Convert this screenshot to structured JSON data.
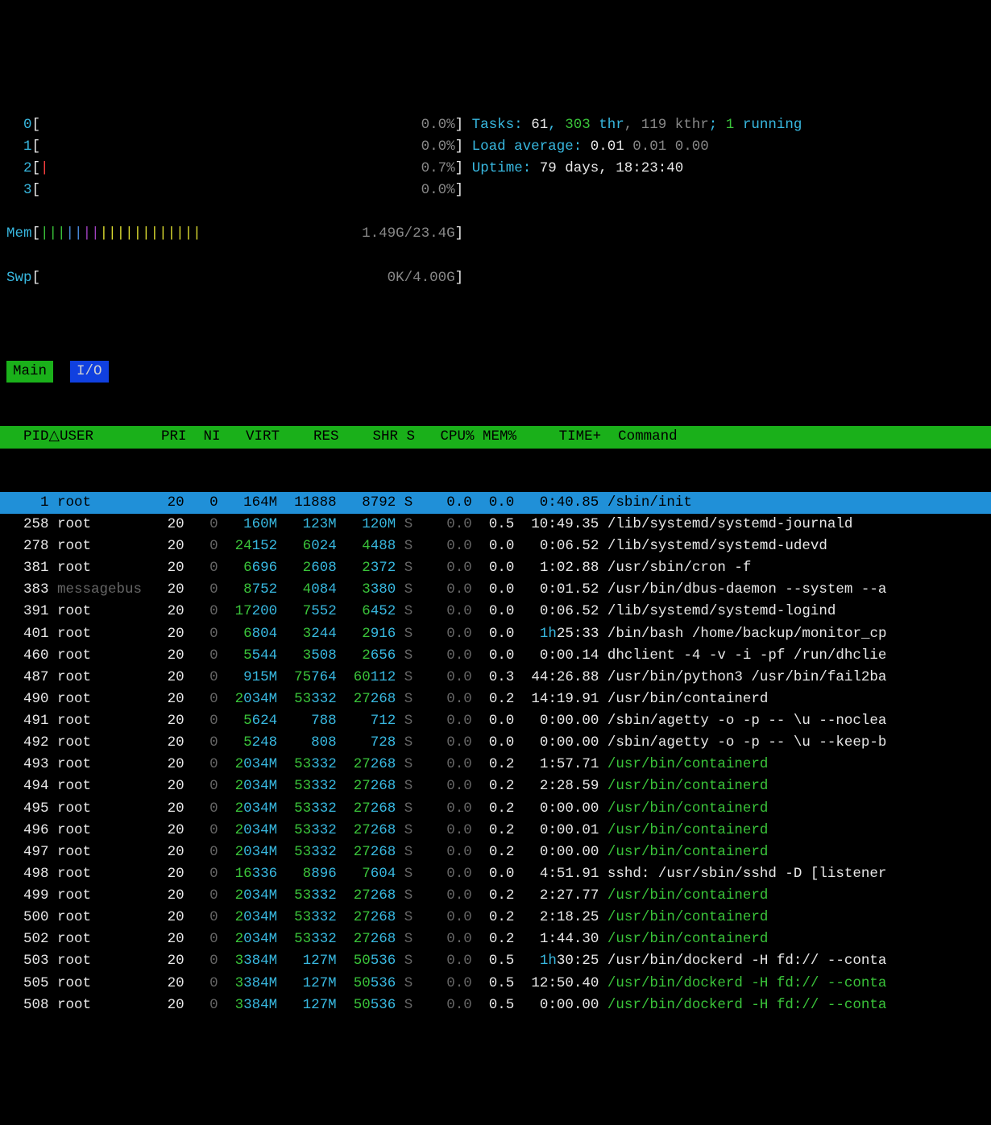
{
  "cpus": [
    {
      "label": "0",
      "bar": "",
      "pct": "0.0%"
    },
    {
      "label": "1",
      "bar": "",
      "pct": "0.0%"
    },
    {
      "label": "2",
      "bar": "|",
      "pct": "0.7%"
    },
    {
      "label": "3",
      "bar": "",
      "pct": "0.0%"
    }
  ],
  "mem": {
    "label": "Mem",
    "used": "1.49G",
    "total": "23.4G"
  },
  "swp": {
    "label": "Swp",
    "used": "0K",
    "total": "4.00G"
  },
  "tasks": {
    "label": "Tasks:",
    "count": "61",
    "thr": "303",
    "thr_label": "thr",
    "kthr": "119 kthr",
    "running": "1",
    "running_label": "running"
  },
  "load": {
    "label": "Load average:",
    "v1": "0.01",
    "v2": "0.01",
    "v3": "0.00"
  },
  "uptime": {
    "label": "Uptime:",
    "value": "79 days, 18:23:40"
  },
  "tabs": {
    "main": "Main",
    "io": "I/O"
  },
  "columns": {
    "pid": "PID",
    "sort": "△",
    "user": "USER",
    "pri": "PRI",
    "ni": "NI",
    "virt": "VIRT",
    "res": "RES",
    "shr": "SHR",
    "s": "S",
    "cpu": "CPU%",
    "mem": "MEM%",
    "time": "TIME+",
    "cmd": "Command"
  },
  "processes": [
    {
      "pid": "1",
      "user": "root",
      "pri": "20",
      "ni": "0",
      "virt": "164M",
      "res": "11888",
      "shr": "8792",
      "s": "S",
      "cpu": "0.0",
      "mem": "0.0",
      "time": "0:40.85",
      "cmd": "/sbin/init",
      "selected": true
    },
    {
      "pid": "258",
      "user": "root",
      "pri": "20",
      "ni": "0",
      "virt": "160M",
      "res": "123M",
      "shr": "120M",
      "s": "S",
      "cpu": "0.0",
      "mem": "0.5",
      "time": "10:49.35",
      "cmd": "/lib/systemd/systemd-journald"
    },
    {
      "pid": "278",
      "user": "root",
      "pri": "20",
      "ni": "0",
      "virt_hi": "24",
      "virt_lo": "152",
      "res_hi": "6",
      "res_lo": "024",
      "shr_hi": "4",
      "shr_lo": "488",
      "s": "S",
      "cpu": "0.0",
      "mem": "0.0",
      "time": "0:06.52",
      "cmd": "/lib/systemd/systemd-udevd"
    },
    {
      "pid": "381",
      "user": "root",
      "pri": "20",
      "ni": "0",
      "virt_hi": "6",
      "virt_lo": "696",
      "res_hi": "2",
      "res_lo": "608",
      "shr_hi": "2",
      "shr_lo": "372",
      "s": "S",
      "cpu": "0.0",
      "mem": "0.0",
      "time": "1:02.88",
      "cmd": "/usr/sbin/cron -f"
    },
    {
      "pid": "383",
      "user": "messagebus",
      "pri": "20",
      "ni": "0",
      "virt_hi": "8",
      "virt_lo": "752",
      "res_hi": "4",
      "res_lo": "084",
      "shr_hi": "3",
      "shr_lo": "380",
      "s": "S",
      "cpu": "0.0",
      "mem": "0.0",
      "time": "0:01.52",
      "cmd": "/usr/bin/dbus-daemon --system --a",
      "dim": true
    },
    {
      "pid": "391",
      "user": "root",
      "pri": "20",
      "ni": "0",
      "virt_hi": "17",
      "virt_lo": "200",
      "res_hi": "7",
      "res_lo": "552",
      "shr_hi": "6",
      "shr_lo": "452",
      "s": "S",
      "cpu": "0.0",
      "mem": "0.0",
      "time": "0:06.52",
      "cmd": "/lib/systemd/systemd-logind"
    },
    {
      "pid": "401",
      "user": "root",
      "pri": "20",
      "ni": "0",
      "virt_hi": "6",
      "virt_lo": "804",
      "res_hi": "3",
      "res_lo": "244",
      "shr_hi": "2",
      "shr_lo": "916",
      "s": "S",
      "cpu": "0.0",
      "mem": "0.0",
      "time_hi": "1h",
      "time_lo": "25:33",
      "cmd": "/bin/bash /home/backup/monitor_cp"
    },
    {
      "pid": "460",
      "user": "root",
      "pri": "20",
      "ni": "0",
      "virt_hi": "5",
      "virt_lo": "544",
      "res_hi": "3",
      "res_lo": "508",
      "shr_hi": "2",
      "shr_lo": "656",
      "s": "S",
      "cpu": "0.0",
      "mem": "0.0",
      "time": "0:00.14",
      "cmd": "dhclient -4 -v -i -pf /run/dhclie"
    },
    {
      "pid": "487",
      "user": "root",
      "pri": "20",
      "ni": "0",
      "virt": "915M",
      "res_hi": "75",
      "res_lo": "764",
      "shr_hi": "60",
      "shr_lo": "112",
      "s": "S",
      "cpu": "0.0",
      "mem": "0.3",
      "time": "44:26.88",
      "cmd": "/usr/bin/python3 /usr/bin/fail2ba"
    },
    {
      "pid": "490",
      "user": "root",
      "pri": "20",
      "ni": "0",
      "virt_hi": "2",
      "virt_lo": "034M",
      "res_hi": "53",
      "res_lo": "332",
      "shr_hi": "27",
      "shr_lo": "268",
      "s": "S",
      "cpu": "0.0",
      "mem": "0.2",
      "time": "14:19.91",
      "cmd": "/usr/bin/containerd"
    },
    {
      "pid": "491",
      "user": "root",
      "pri": "20",
      "ni": "0",
      "virt_hi": "5",
      "virt_lo": "624",
      "res": "788",
      "shr": "712",
      "s": "S",
      "cpu": "0.0",
      "mem": "0.0",
      "time": "0:00.00",
      "cmd": "/sbin/agetty -o -p -- \\u --noclea"
    },
    {
      "pid": "492",
      "user": "root",
      "pri": "20",
      "ni": "0",
      "virt_hi": "5",
      "virt_lo": "248",
      "res": "808",
      "shr": "728",
      "s": "S",
      "cpu": "0.0",
      "mem": "0.0",
      "time": "0:00.00",
      "cmd": "/sbin/agetty -o -p -- \\u --keep-b"
    },
    {
      "pid": "493",
      "user": "root",
      "pri": "20",
      "ni": "0",
      "virt_hi": "2",
      "virt_lo": "034M",
      "res_hi": "53",
      "res_lo": "332",
      "shr_hi": "27",
      "shr_lo": "268",
      "s": "S",
      "cpu": "0.0",
      "mem": "0.2",
      "time": "1:57.71",
      "cmd": "/usr/bin/containerd",
      "thread": true
    },
    {
      "pid": "494",
      "user": "root",
      "pri": "20",
      "ni": "0",
      "virt_hi": "2",
      "virt_lo": "034M",
      "res_hi": "53",
      "res_lo": "332",
      "shr_hi": "27",
      "shr_lo": "268",
      "s": "S",
      "cpu": "0.0",
      "mem": "0.2",
      "time": "2:28.59",
      "cmd": "/usr/bin/containerd",
      "thread": true
    },
    {
      "pid": "495",
      "user": "root",
      "pri": "20",
      "ni": "0",
      "virt_hi": "2",
      "virt_lo": "034M",
      "res_hi": "53",
      "res_lo": "332",
      "shr_hi": "27",
      "shr_lo": "268",
      "s": "S",
      "cpu": "0.0",
      "mem": "0.2",
      "time": "0:00.00",
      "cmd": "/usr/bin/containerd",
      "thread": true
    },
    {
      "pid": "496",
      "user": "root",
      "pri": "20",
      "ni": "0",
      "virt_hi": "2",
      "virt_lo": "034M",
      "res_hi": "53",
      "res_lo": "332",
      "shr_hi": "27",
      "shr_lo": "268",
      "s": "S",
      "cpu": "0.0",
      "mem": "0.2",
      "time": "0:00.01",
      "cmd": "/usr/bin/containerd",
      "thread": true
    },
    {
      "pid": "497",
      "user": "root",
      "pri": "20",
      "ni": "0",
      "virt_hi": "2",
      "virt_lo": "034M",
      "res_hi": "53",
      "res_lo": "332",
      "shr_hi": "27",
      "shr_lo": "268",
      "s": "S",
      "cpu": "0.0",
      "mem": "0.2",
      "time": "0:00.00",
      "cmd": "/usr/bin/containerd",
      "thread": true
    },
    {
      "pid": "498",
      "user": "root",
      "pri": "20",
      "ni": "0",
      "virt_hi": "16",
      "virt_lo": "336",
      "res_hi": "8",
      "res_lo": "896",
      "shr_hi": "7",
      "shr_lo": "604",
      "s": "S",
      "cpu": "0.0",
      "mem": "0.0",
      "time": "4:51.91",
      "cmd": "sshd: /usr/sbin/sshd -D [listener"
    },
    {
      "pid": "499",
      "user": "root",
      "pri": "20",
      "ni": "0",
      "virt_hi": "2",
      "virt_lo": "034M",
      "res_hi": "53",
      "res_lo": "332",
      "shr_hi": "27",
      "shr_lo": "268",
      "s": "S",
      "cpu": "0.0",
      "mem": "0.2",
      "time": "2:27.77",
      "cmd": "/usr/bin/containerd",
      "thread": true
    },
    {
      "pid": "500",
      "user": "root",
      "pri": "20",
      "ni": "0",
      "virt_hi": "2",
      "virt_lo": "034M",
      "res_hi": "53",
      "res_lo": "332",
      "shr_hi": "27",
      "shr_lo": "268",
      "s": "S",
      "cpu": "0.0",
      "mem": "0.2",
      "time": "2:18.25",
      "cmd": "/usr/bin/containerd",
      "thread": true
    },
    {
      "pid": "502",
      "user": "root",
      "pri": "20",
      "ni": "0",
      "virt_hi": "2",
      "virt_lo": "034M",
      "res_hi": "53",
      "res_lo": "332",
      "shr_hi": "27",
      "shr_lo": "268",
      "s": "S",
      "cpu": "0.0",
      "mem": "0.2",
      "time": "1:44.30",
      "cmd": "/usr/bin/containerd",
      "thread": true
    },
    {
      "pid": "503",
      "user": "root",
      "pri": "20",
      "ni": "0",
      "virt_hi": "3",
      "virt_lo": "384M",
      "res": "127M",
      "shr_hi": "50",
      "shr_lo": "536",
      "s": "S",
      "cpu": "0.0",
      "mem": "0.5",
      "time_hi": "1h",
      "time_lo": "30:25",
      "cmd": "/usr/bin/dockerd -H fd:// --conta"
    },
    {
      "pid": "505",
      "user": "root",
      "pri": "20",
      "ni": "0",
      "virt_hi": "3",
      "virt_lo": "384M",
      "res": "127M",
      "shr_hi": "50",
      "shr_lo": "536",
      "s": "S",
      "cpu": "0.0",
      "mem": "0.5",
      "time": "12:50.40",
      "cmd": "/usr/bin/dockerd -H fd:// --conta",
      "thread": true
    },
    {
      "pid": "508",
      "user": "root",
      "pri": "20",
      "ni": "0",
      "virt_hi": "3",
      "virt_lo": "384M",
      "res": "127M",
      "shr_hi": "50",
      "shr_lo": "536",
      "s": "S",
      "cpu": "0.0",
      "mem": "0.5",
      "time": "0:00.00",
      "cmd": "/usr/bin/dockerd -H fd:// --conta",
      "thread": true
    }
  ]
}
